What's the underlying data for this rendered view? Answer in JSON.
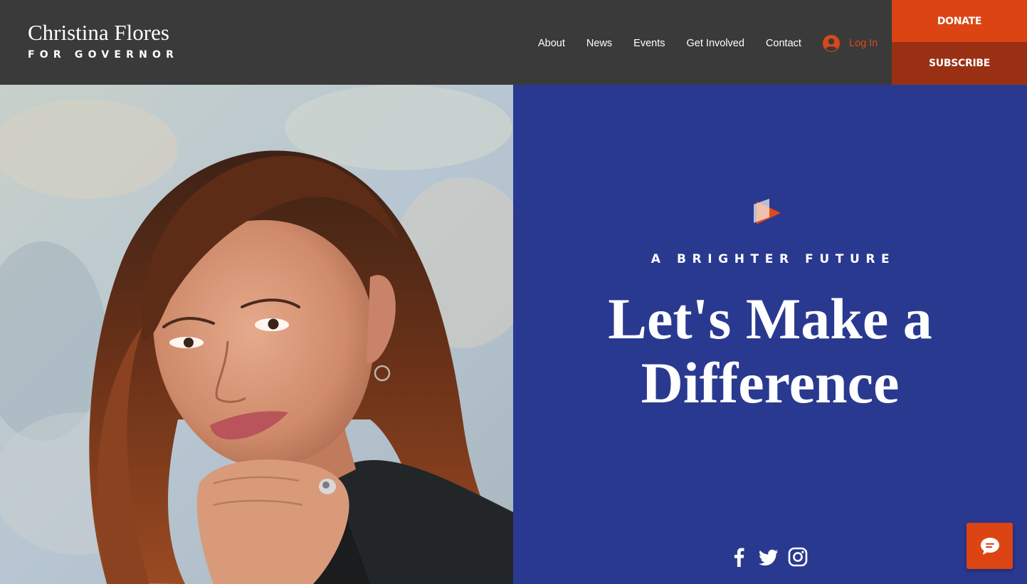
{
  "brand": {
    "name": "Christina Flores",
    "subtitle": "FOR GOVERNOR"
  },
  "nav": {
    "items": [
      {
        "label": "About"
      },
      {
        "label": "News"
      },
      {
        "label": "Events"
      },
      {
        "label": "Get Involved"
      },
      {
        "label": "Contact"
      }
    ],
    "login_label": "Log In"
  },
  "cta": {
    "donate_label": "DONATE",
    "subscribe_label": "SUBSCRIBE"
  },
  "hero": {
    "eyebrow": "A BRIGHTER FUTURE",
    "headline_line1": "Let's Make a",
    "headline_line2": "Difference"
  },
  "social": {
    "icons": [
      "facebook-icon",
      "twitter-icon",
      "instagram-icon"
    ]
  },
  "colors": {
    "header_bg": "#3a3a3a",
    "accent_orange": "#dc4513",
    "subscribe_bg": "#993014",
    "hero_blue": "#2a3990",
    "text_white": "#ffffff"
  },
  "icons": {
    "login": "user-avatar-icon",
    "logo": "play-flag-logo-icon",
    "chat": "chat-bubble-icon"
  }
}
